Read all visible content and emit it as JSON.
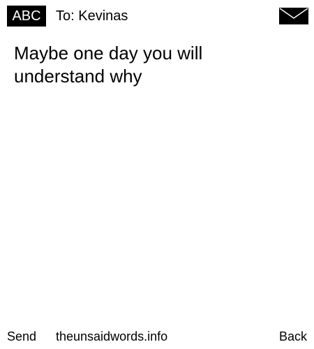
{
  "header": {
    "input_mode": "ABC",
    "recipient": "To: Kevinas",
    "icon": "envelope-icon"
  },
  "message": {
    "text": "Maybe one day you will understand why"
  },
  "footer": {
    "left_softkey": "Send",
    "center_text": "theunsaidwords.info",
    "right_softkey": "Back"
  },
  "colors": {
    "background": "#ffffff",
    "foreground": "#000000"
  }
}
